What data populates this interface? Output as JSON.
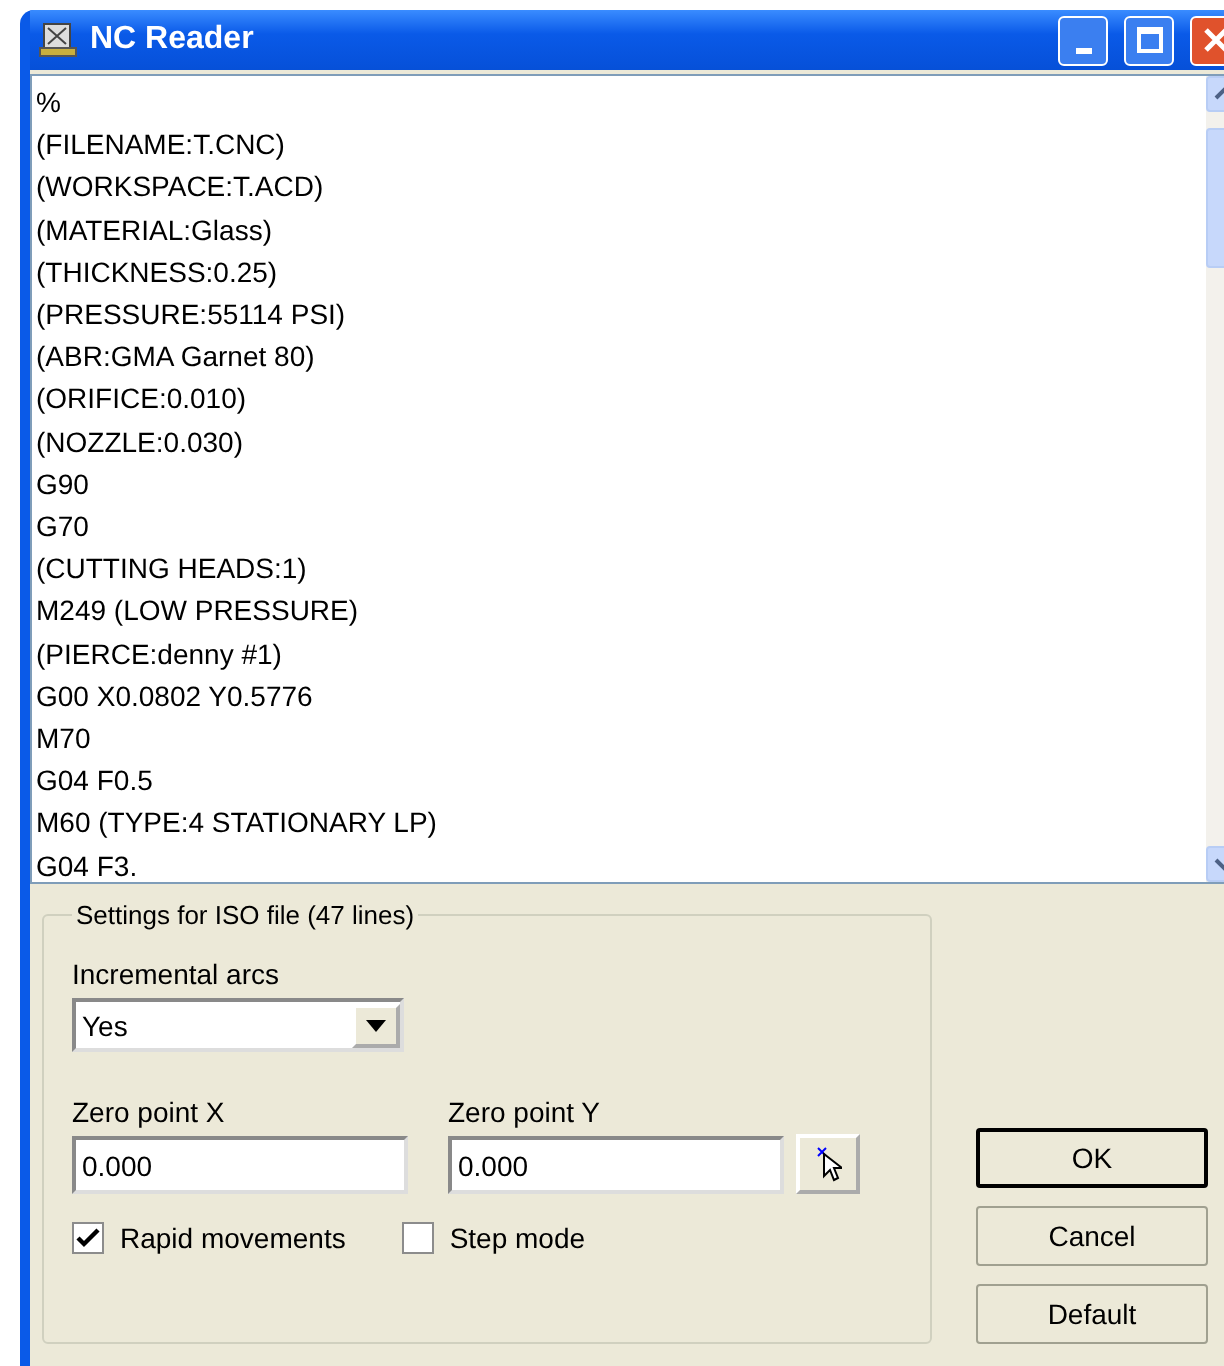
{
  "window": {
    "title": "NC Reader"
  },
  "code_lines": [
    "%",
    "(FILENAME:T.CNC)",
    "(WORKSPACE:T.ACD)",
    "(MATERIAL:Glass)",
    "(THICKNESS:0.25)",
    "(PRESSURE:55114 PSI)",
    "(ABR:GMA Garnet 80)",
    "(ORIFICE:0.010)",
    "(NOZZLE:0.030)",
    "G90",
    "G70",
    "(CUTTING HEADS:1)",
    "M249 (LOW PRESSURE)",
    "(PIERCE:denny #1)",
    "G00 X0.0802 Y0.5776",
    "M70",
    "G04 F0.5",
    "M60 (TYPE:4 STATIONARY LP)",
    "G04 F3."
  ],
  "settings": {
    "title": "Settings for ISO file (47 lines)",
    "incremental_arcs": {
      "label": "Incremental arcs",
      "value": "Yes"
    },
    "zero_x": {
      "label": "Zero point X",
      "value": "0.000"
    },
    "zero_y": {
      "label": "Zero point Y",
      "value": "0.000"
    },
    "checkboxes": [
      {
        "label": "Rapid movements",
        "checked": true
      },
      {
        "label": "Step mode",
        "checked": false
      }
    ]
  },
  "buttons": [
    "OK",
    "Cancel",
    "Default"
  ]
}
